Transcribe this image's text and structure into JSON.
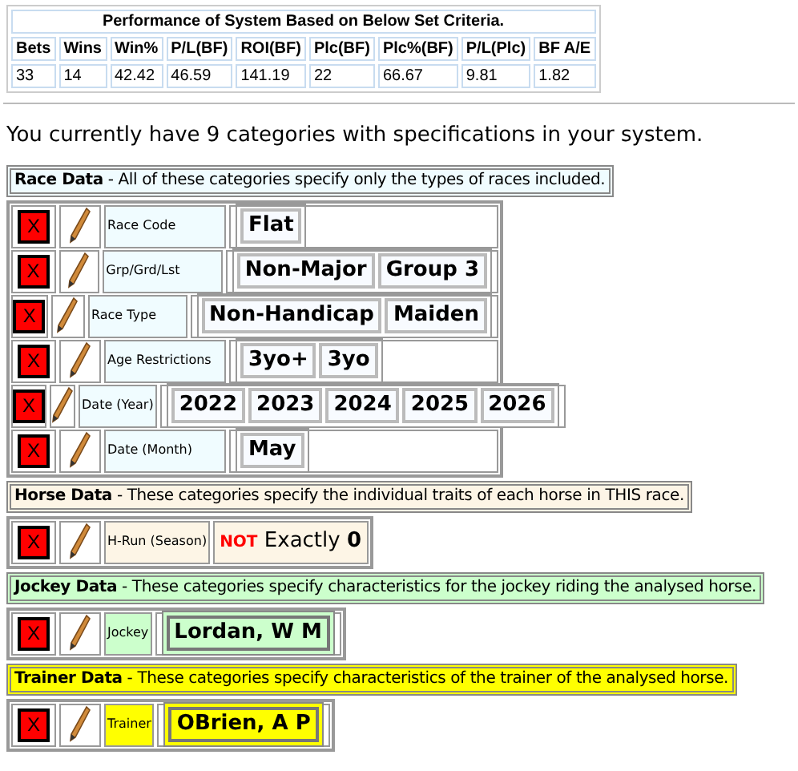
{
  "performance": {
    "title": "Performance of System Based on Below Set Criteria.",
    "columns": [
      "Bets",
      "Wins",
      "Win%",
      "P/L(BF)",
      "ROI(BF)",
      "Plc(BF)",
      "Plc%(BF)",
      "P/L(Plc)",
      "BF A/E"
    ],
    "values": [
      "33",
      "14",
      "42.42",
      "46.59",
      "141.19",
      "22",
      "66.67",
      "9.81",
      "1.82"
    ]
  },
  "summary": "You currently have 9 categories with specifications in your system.",
  "sections": [
    {
      "title": "Race Data",
      "description": " - All of these categories specify only the types of races included.",
      "color": "#f0fcff",
      "rows": [
        {
          "delete": "X",
          "label": "Race Code",
          "kind": "chips",
          "values": [
            "Flat"
          ]
        },
        {
          "delete": "X",
          "label": "Grp/Grd/Lst",
          "kind": "chips",
          "values": [
            "Non-Major",
            "Group 3"
          ]
        },
        {
          "delete": "X",
          "label": "Race Type",
          "kind": "chips",
          "values": [
            "Non-Handicap",
            "Maiden"
          ]
        },
        {
          "delete": "X",
          "label": "Age Restrictions",
          "kind": "chips",
          "values": [
            "3yo+",
            "3yo"
          ]
        },
        {
          "delete": "X",
          "label": "Date (Year)",
          "kind": "chips",
          "values": [
            "2022",
            "2023",
            "2024",
            "2025",
            "2026"
          ]
        },
        {
          "delete": "X",
          "label": "Date (Month)",
          "kind": "chips",
          "values": [
            "May"
          ]
        }
      ]
    },
    {
      "title": "Horse Data",
      "description": " - These categories specify the individual traits of each horse in THIS race.",
      "color": "#fdf5e6",
      "rows": [
        {
          "delete": "X",
          "label": "H-Run (Season)",
          "kind": "condition",
          "negation": "NOT",
          "operator": "Exactly",
          "value": "0"
        }
      ]
    },
    {
      "title": "Jockey Data",
      "description": " - These categories specify characteristics for the jockey riding the analysed horse.",
      "color": "#ccffcc",
      "rows": [
        {
          "delete": "X",
          "label": "Jockey",
          "kind": "named",
          "values": [
            "Lordan, W M"
          ]
        }
      ]
    },
    {
      "title": "Trainer Data",
      "description": " - These categories specify characteristics of the trainer of the analysed horse.",
      "color": "#ffff00",
      "rows": [
        {
          "delete": "X",
          "label": "Trainer",
          "kind": "named",
          "values": [
            "OBrien, A P"
          ]
        }
      ]
    }
  ]
}
